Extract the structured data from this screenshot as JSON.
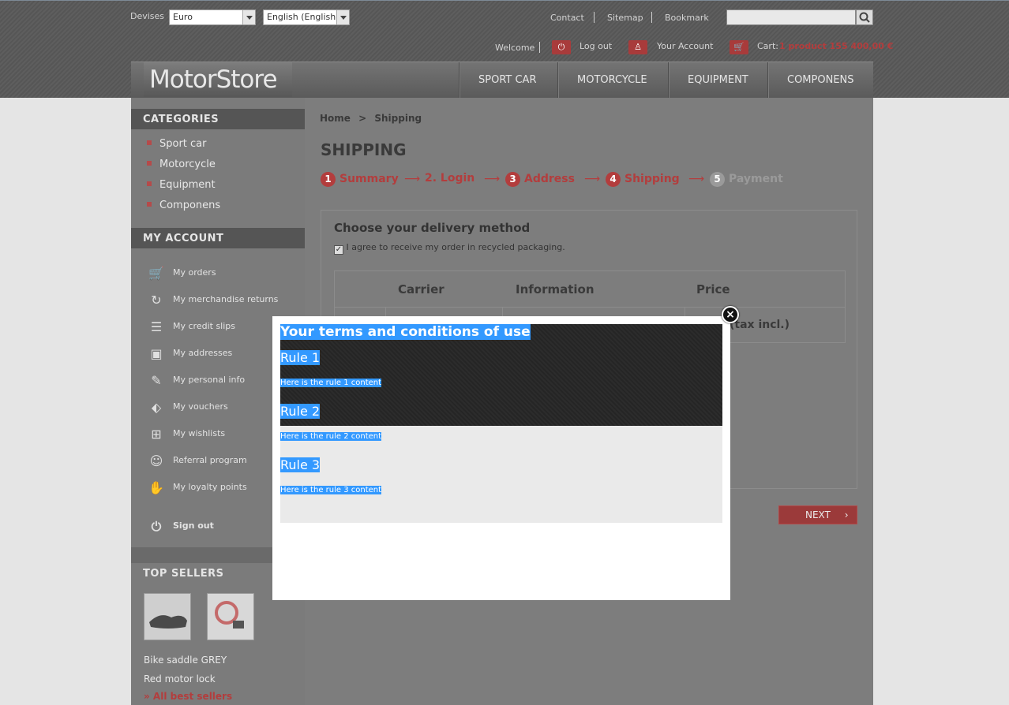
{
  "header": {
    "currency_label": "Devises",
    "currency_value": "Euro",
    "language_value": "English (English)",
    "links": [
      "Contact",
      "Sitemap",
      "Bookmark"
    ],
    "search_placeholder": "",
    "welcome": "Welcome",
    "logout": "Log out",
    "account": "Your Account",
    "cart_label": "Cart:",
    "cart_value": "1 product 155 400,00 €",
    "logo": "MotorStore",
    "nav": [
      "SPORT CAR",
      "MOTORCYCLE",
      "EQUIPMENT",
      "COMPONENS"
    ]
  },
  "sidebar": {
    "categories_title": "CATEGORIES",
    "categories": [
      "Sport car",
      "Motorcycle",
      "Equipment",
      "Componens"
    ],
    "account_title": "MY ACCOUNT",
    "account_items": [
      {
        "label": "My orders",
        "icon": "cart-icon"
      },
      {
        "label": "My merchandise returns",
        "icon": "refresh-icon"
      },
      {
        "label": "My credit slips",
        "icon": "document-icon"
      },
      {
        "label": "My addresses",
        "icon": "address-card-icon"
      },
      {
        "label": "My personal info",
        "icon": "edit-icon"
      },
      {
        "label": "My vouchers",
        "icon": "tag-icon"
      },
      {
        "label": "My wishlists",
        "icon": "gift-icon"
      },
      {
        "label": "Referral program",
        "icon": "user-face-icon"
      },
      {
        "label": "My loyalty points",
        "icon": "thumbs-up-icon"
      }
    ],
    "signout": "Sign out",
    "top_sellers_title": "TOP SELLERS",
    "top_sellers": [
      "Bike saddle GREY",
      "Red motor lock"
    ],
    "all_best_sellers": "» All best sellers"
  },
  "main": {
    "breadcrumb_home": "Home",
    "breadcrumb_sep": ">",
    "breadcrumb_current": "Shipping",
    "title": "SHIPPING",
    "steps": [
      {
        "num": "1",
        "label": "Summary"
      },
      {
        "num": "",
        "label": "2. Login"
      },
      {
        "num": "3",
        "label": "Address"
      },
      {
        "num": "4",
        "label": "Shipping"
      },
      {
        "num": "5",
        "label": "Payment"
      }
    ],
    "delivery_title": "Choose your delivery method",
    "recycle_label": "I agree to receive my order in recycled packaging.",
    "recycle_checked": true,
    "table_headers": [
      "Carrier",
      "Information",
      "Price"
    ],
    "price_note": "(tax incl.)",
    "next_label": "NEXT"
  },
  "modal": {
    "title": "Your terms and conditions of use",
    "rules": [
      {
        "title": "Rule 1",
        "content": "Here is the rule 1 content"
      },
      {
        "title": "Rule 2",
        "content": "Here is the rule 2 content"
      },
      {
        "title": "Rule 3",
        "content": "Here is the rule 3 content"
      }
    ],
    "close_glyph": "×"
  }
}
